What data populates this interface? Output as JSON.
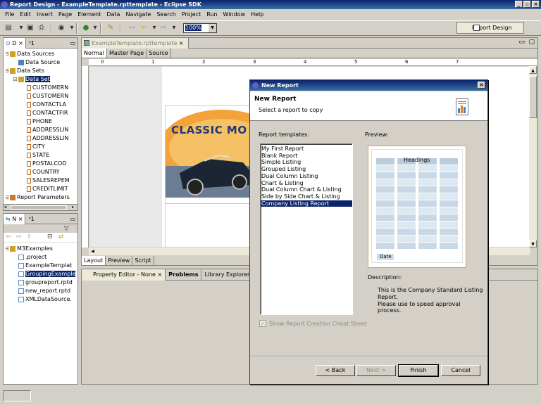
{
  "window": {
    "title": "Report Design - ExampleTemplate.rpttemplate - Eclipse SDK"
  },
  "menu": [
    "File",
    "Edit",
    "Insert",
    "Page",
    "Element",
    "Data",
    "Navigate",
    "Search",
    "Project",
    "Run",
    "Window",
    "Help"
  ],
  "toolbar": {
    "zoom": "100%",
    "perspective": "Report Design"
  },
  "data_explorer": {
    "tab_label": "D",
    "tab2_label": "1",
    "items": [
      {
        "label": "Data Sources",
        "level": 0,
        "icon": "folder-icon"
      },
      {
        "label": "Data Source",
        "level": 1,
        "icon": "database-icon"
      },
      {
        "label": "Data Sets",
        "level": 0,
        "icon": "folder-icon"
      },
      {
        "label": "Data Set",
        "level": 1,
        "icon": "dataset-icon",
        "selected": true
      },
      {
        "label": "CUSTOMERN",
        "level": 2,
        "icon": "column-icon"
      },
      {
        "label": "CUSTOMERN",
        "level": 2,
        "icon": "column-icon"
      },
      {
        "label": "CONTACTLA",
        "level": 2,
        "icon": "column-icon"
      },
      {
        "label": "CONTACTFIR",
        "level": 2,
        "icon": "column-icon"
      },
      {
        "label": "PHONE",
        "level": 2,
        "icon": "column-icon"
      },
      {
        "label": "ADDRESSLIN",
        "level": 2,
        "icon": "column-icon"
      },
      {
        "label": "ADDRESSLIN",
        "level": 2,
        "icon": "column-icon"
      },
      {
        "label": "CITY",
        "level": 2,
        "icon": "column-icon"
      },
      {
        "label": "STATE",
        "level": 2,
        "icon": "column-icon"
      },
      {
        "label": "POSTALCOD",
        "level": 2,
        "icon": "column-icon"
      },
      {
        "label": "COUNTRY",
        "level": 2,
        "icon": "column-icon"
      },
      {
        "label": "SALESREPEM",
        "level": 2,
        "icon": "column-icon"
      },
      {
        "label": "CREDITLIMIT",
        "level": 2,
        "icon": "column-icon"
      },
      {
        "label": "Report Parameters",
        "level": 0,
        "icon": "parameter-icon"
      }
    ]
  },
  "navigator": {
    "tab_label": "N",
    "tab2_label": "1",
    "items": [
      {
        "label": "M3Examples",
        "level": 0,
        "icon": "project-icon"
      },
      {
        "label": ".project",
        "level": 1,
        "icon": "file-icon"
      },
      {
        "label": "ExampleTemplat",
        "level": 1,
        "icon": "file-icon"
      },
      {
        "label": "GroupingExample",
        "level": 1,
        "icon": "file-icon",
        "selected": true
      },
      {
        "label": "groupreport.rptd",
        "level": 1,
        "icon": "file-icon"
      },
      {
        "label": "new_report.rptd",
        "level": 1,
        "icon": "file-icon"
      },
      {
        "label": "XMLDataSource.",
        "level": 1,
        "icon": "file-icon"
      }
    ]
  },
  "editor": {
    "tab": "ExampleTemplate.rpttemplate",
    "subtabs": [
      "Normal",
      "Master Page",
      "Source"
    ],
    "bottom_tabs": [
      "Layout",
      "Preview",
      "Script"
    ],
    "ruler_numbers": [
      "0",
      "1",
      "2",
      "3",
      "4",
      "5",
      "6",
      "7"
    ],
    "logo_text": "CLASSIC MO"
  },
  "bottom_panel": {
    "tabs": [
      "Property Editor - None",
      "Problems",
      "Library Explorer"
    ]
  },
  "dialog": {
    "title": "New Report",
    "heading": "New Report",
    "subheading": "Select a report to copy",
    "templates_label": "Report templates:",
    "preview_label": "Preview:",
    "templates": [
      "My First Report",
      "Blank Report",
      "Simple Listing",
      "Grouped Listing",
      "Dual Column Listing",
      "Chart & Listing",
      "Dual Column Chart & Listing",
      "Side by Side Chart & Listing",
      "Company Listing Report"
    ],
    "selected_template": "Company Listing Report",
    "preview_heading": "Headings",
    "preview_footer": "Date",
    "description_label": "Description:",
    "description": "This is the Company Standard Listing Report.\nPlease use to speed approval process.",
    "cheat_sheet_label": "Show Report Creation Cheat Sheet",
    "cheat_sheet_checked": true,
    "buttons": {
      "back": "< Back",
      "next": "Next >",
      "finish": "Finish",
      "cancel": "Cancel"
    }
  }
}
